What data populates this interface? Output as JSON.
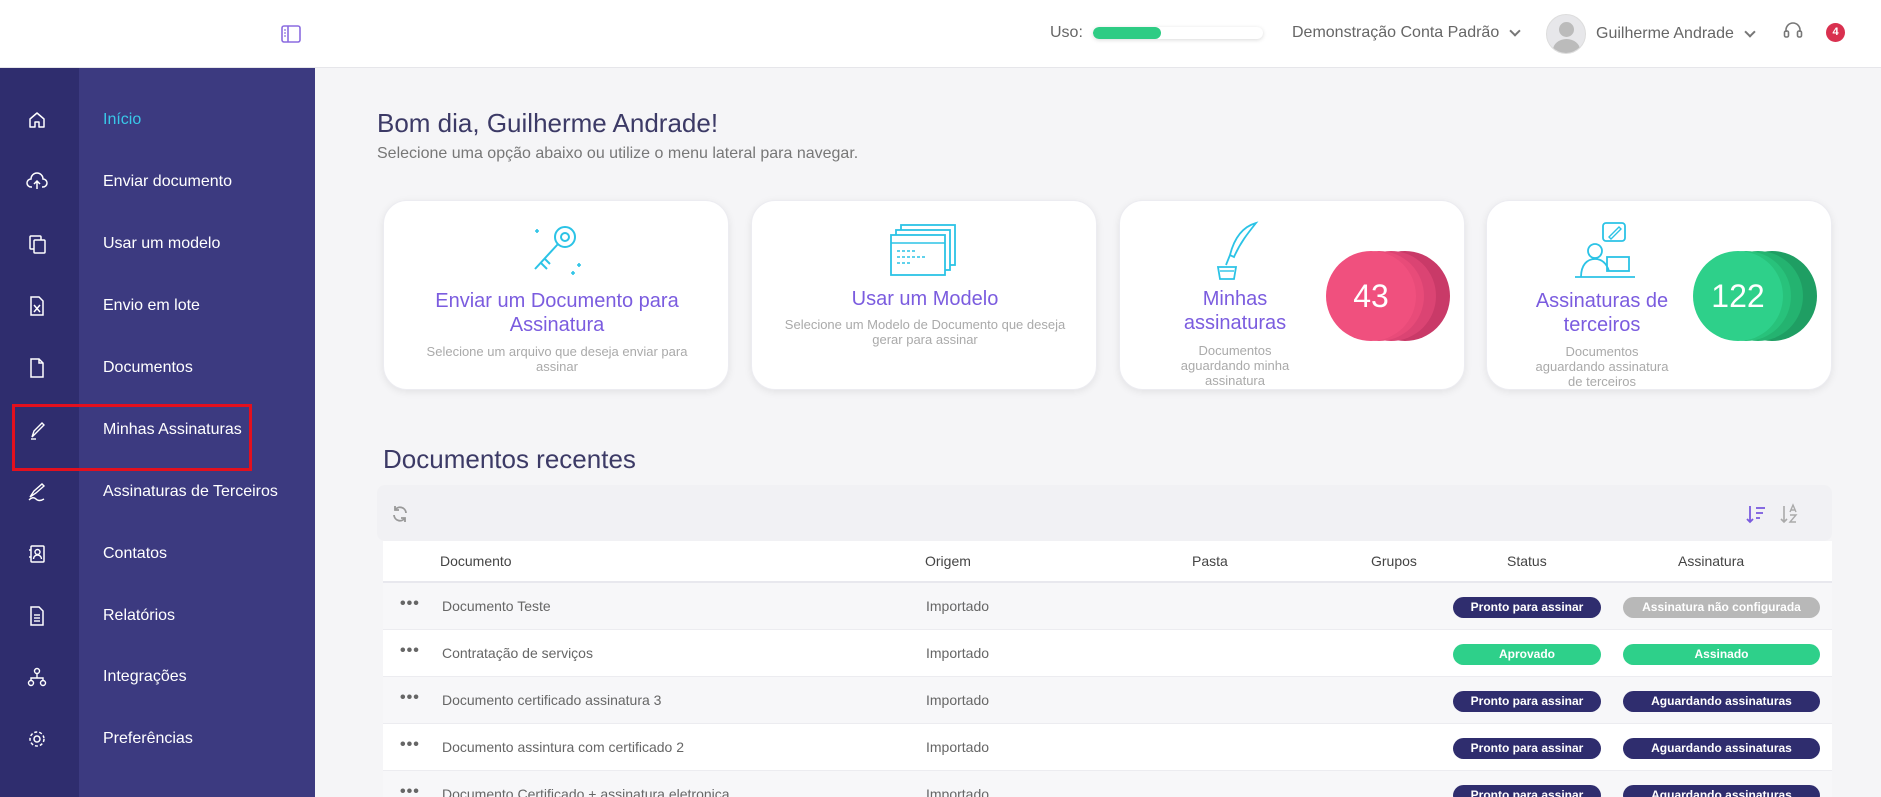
{
  "topbar": {
    "usage_label": "Uso:",
    "usage_fraction": 0.4,
    "account_name": "Demonstração Conta Padrão",
    "user_name": "Guilherme Andrade",
    "notification_count": "4"
  },
  "sidebar": {
    "items": [
      {
        "label": "Início",
        "icon": "home-icon"
      },
      {
        "label": "Enviar documento",
        "icon": "cloud-upload-icon"
      },
      {
        "label": "Usar um modelo",
        "icon": "template-icon"
      },
      {
        "label": "Envio em lote",
        "icon": "spreadsheet-icon"
      },
      {
        "label": "Documentos",
        "icon": "document-icon"
      },
      {
        "label": "Minhas Assinaturas",
        "icon": "pen-icon"
      },
      {
        "label": "Assinaturas de Terceiros",
        "icon": "signature-icon"
      },
      {
        "label": "Contatos",
        "icon": "contacts-icon"
      },
      {
        "label": "Relatórios",
        "icon": "report-icon"
      },
      {
        "label": "Integrações",
        "icon": "integrations-icon"
      },
      {
        "label": "Preferências",
        "icon": "gear-icon"
      }
    ]
  },
  "main": {
    "greeting": "Bom dia, Guilherme Andrade!",
    "subtitle": "Selecione uma opção abaixo ou utilize o menu lateral para navegar.",
    "cards": [
      {
        "title": "Enviar um Documento para Assinatura",
        "description": "Selecione um arquivo que deseja enviar para assinar"
      },
      {
        "title": "Usar um Modelo",
        "description": "Selecione um Modelo de Documento que deseja gerar para assinar"
      },
      {
        "title": "Minhas assinaturas",
        "description": "Documentos aguardando minha assinatura",
        "count": "43"
      },
      {
        "title": "Assinaturas de terceiros",
        "description": "Documentos aguardando assinatura de terceiros",
        "count": "122"
      }
    ],
    "recent_title": "Documentos recentes"
  },
  "table": {
    "headers": {
      "documento": "Documento",
      "origem": "Origem",
      "pasta": "Pasta",
      "grupos": "Grupos",
      "status": "Status",
      "assinatura": "Assinatura"
    },
    "more_label": "•••",
    "rows": [
      {
        "documento": "Documento Teste",
        "origem": "Importado",
        "status": "Pronto para assinar",
        "assinatura": "Assinatura não configurada"
      },
      {
        "documento": "Contratação de serviços",
        "origem": "Importado",
        "status": "Aprovado",
        "assinatura": "Assinado"
      },
      {
        "documento": "Documento certificado assinatura 3",
        "origem": "Importado",
        "status": "Pronto para assinar",
        "assinatura": "Aguardando assinaturas"
      },
      {
        "documento": "Documento assintura com certificado 2",
        "origem": "Importado",
        "status": "Pronto para assinar",
        "assinatura": "Aguardando assinaturas"
      },
      {
        "documento": "Documento Certificado + assinatura eletronica",
        "origem": "Importado",
        "status": "Pronto para assinar",
        "assinatura": "Aguardando assinaturas"
      }
    ]
  },
  "colors": {
    "sidebar": "#3c3a80",
    "rail": "#2f2d6e",
    "active": "#39c8e8",
    "accent": "#7b5cdf",
    "pink": "#f0507e",
    "green": "#2ed08a",
    "dark_badge": "#2f2d6e"
  }
}
